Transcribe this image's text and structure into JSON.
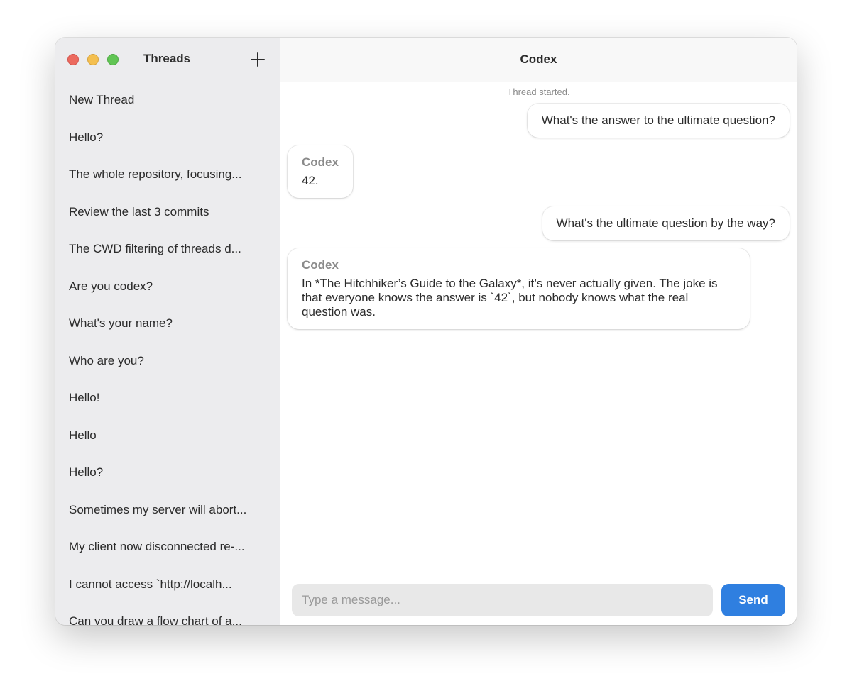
{
  "sidebar": {
    "title": "Threads",
    "new_thread_icon": "plus-icon",
    "threads": [
      "New Thread",
      "Hello?",
      "The whole repository, focusing...",
      "Review the last 3 commits",
      "The CWD filtering of threads d...",
      "Are you codex?",
      "What's your name?",
      "Who are you?",
      "Hello!",
      "Hello",
      "Hello?",
      "Sometimes my server will abort...",
      "My client now disconnected re-...",
      "I cannot access `http://localh...",
      "Can you draw a flow chart of a..."
    ]
  },
  "main": {
    "title": "Codex",
    "system_note": "Thread started.",
    "messages": [
      {
        "role": "user",
        "text": "What's the answer to the ultimate question?"
      },
      {
        "role": "assistant",
        "sender": "Codex",
        "text": "42."
      },
      {
        "role": "user",
        "text": "What's the ultimate question by the way?"
      },
      {
        "role": "assistant",
        "sender": "Codex",
        "text": "In *The Hitchhiker’s Guide to the Galaxy*, it’s never actually given. The joke is that everyone knows the answer is `42`, but nobody knows what the real question was."
      }
    ]
  },
  "composer": {
    "placeholder": "Type a message...",
    "value": "",
    "send_label": "Send"
  },
  "colors": {
    "accent": "#2f7fe0",
    "sidebar_bg": "#ececee",
    "traffic_close": "#ec6a5e",
    "traffic_minimize": "#f4bf4f",
    "traffic_maximize": "#61c554"
  }
}
